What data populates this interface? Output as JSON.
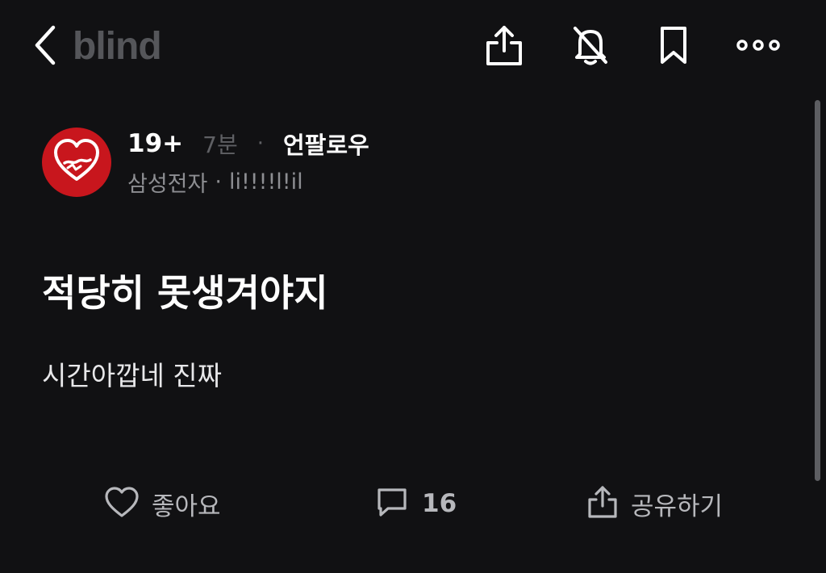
{
  "header": {
    "logo_text": "blind",
    "icons": [
      "back-icon",
      "share-icon",
      "notification-off-icon",
      "bookmark-icon",
      "more-icon"
    ]
  },
  "post": {
    "author": {
      "nickname": "19+",
      "time_ago": "7분",
      "separator": "·",
      "follow_label": "언팔로우",
      "company": "삼성전자",
      "meta_separator": "·",
      "username": "li!!!!l!il",
      "avatar_icon": "heart-avatar-icon"
    },
    "title": "적당히 못생겨야지",
    "body": "시간아깝네 진짜"
  },
  "actions": {
    "like_label": "좋아요",
    "comment_count": "16",
    "share_label": "공유하기"
  },
  "colors": {
    "background": "#111113",
    "accent_red": "#c8161d",
    "muted": "#5f6064",
    "secondary_text": "#8d8e92"
  }
}
